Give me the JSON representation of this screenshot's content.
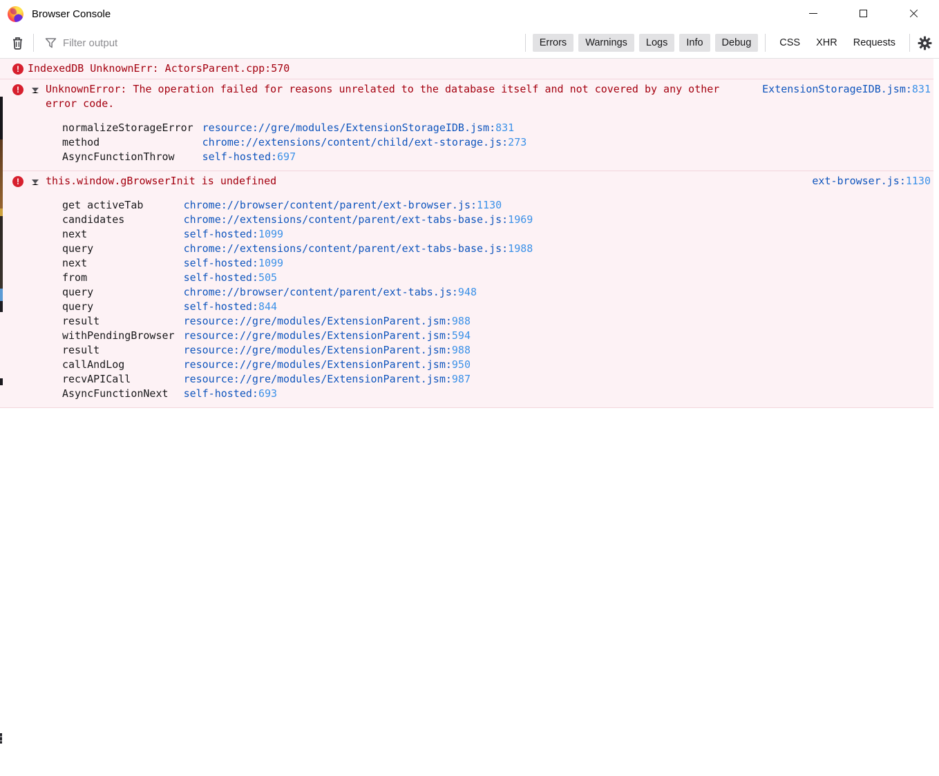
{
  "window": {
    "title": "Browser Console"
  },
  "toolbar": {
    "filter_placeholder": "Filter output",
    "filter_buttons": [
      "Errors",
      "Warnings",
      "Logs",
      "Info",
      "Debug"
    ],
    "category_buttons": [
      "CSS",
      "XHR",
      "Requests"
    ]
  },
  "icons": {
    "app_logo": "firefox-logo",
    "clear_output": "trash-can",
    "filter": "funnel",
    "settings": "gear",
    "window_controls": [
      "minimize",
      "maximize",
      "close"
    ],
    "message_severity": "error-circle-exclamation"
  },
  "palette": {
    "error_text": "#a4000f",
    "error_row_bg": "#fdf2f5",
    "error_row_border": "#f2d5db",
    "error_icon_red": "#d7202e",
    "link_file_blue": "#0f55bd",
    "link_line_blue": "#3b91e8",
    "button_bg": "#e2e2e4"
  },
  "console": {
    "messages": [
      {
        "severity": "error",
        "expandable": false,
        "text": "IndexedDB UnknownErr: ActorsParent.cpp:570",
        "location_file": "",
        "location_line": "",
        "stack": []
      },
      {
        "severity": "error",
        "expandable": true,
        "text": "UnknownError: The operation failed for reasons unrelated to the database itself and not covered by any other error code.",
        "location_file": "ExtensionStorageIDB.jsm",
        "location_line": "831",
        "stack": [
          {
            "fn": "normalizeStorageError",
            "file": "resource://gre/modules/ExtensionStorageIDB.jsm",
            "line": "831"
          },
          {
            "fn": "method",
            "file": "chrome://extensions/content/child/ext-storage.js",
            "line": "273"
          },
          {
            "fn": "AsyncFunctionThrow",
            "file": "self-hosted",
            "line": "697"
          }
        ]
      },
      {
        "severity": "error",
        "expandable": true,
        "text": "this.window.gBrowserInit is undefined",
        "location_file": "ext-browser.js",
        "location_line": "1130",
        "stack": [
          {
            "fn": "get activeTab",
            "file": "chrome://browser/content/parent/ext-browser.js",
            "line": "1130"
          },
          {
            "fn": "candidates",
            "file": "chrome://extensions/content/parent/ext-tabs-base.js",
            "line": "1969"
          },
          {
            "fn": "next",
            "file": "self-hosted",
            "line": "1099"
          },
          {
            "fn": "query",
            "file": "chrome://extensions/content/parent/ext-tabs-base.js",
            "line": "1988"
          },
          {
            "fn": "next",
            "file": "self-hosted",
            "line": "1099"
          },
          {
            "fn": "from",
            "file": "self-hosted",
            "line": "505"
          },
          {
            "fn": "query",
            "file": "chrome://browser/content/parent/ext-tabs.js",
            "line": "948"
          },
          {
            "fn": "query",
            "file": "self-hosted",
            "line": "844"
          },
          {
            "fn": "result",
            "file": "resource://gre/modules/ExtensionParent.jsm",
            "line": "988"
          },
          {
            "fn": "withPendingBrowser",
            "file": "resource://gre/modules/ExtensionParent.jsm",
            "line": "594"
          },
          {
            "fn": "result",
            "file": "resource://gre/modules/ExtensionParent.jsm",
            "line": "988"
          },
          {
            "fn": "callAndLog",
            "file": "resource://gre/modules/ExtensionParent.jsm",
            "line": "950"
          },
          {
            "fn": "recvAPICall",
            "file": "resource://gre/modules/ExtensionParent.jsm",
            "line": "987"
          },
          {
            "fn": "AsyncFunctionNext",
            "file": "self-hosted",
            "line": "693"
          }
        ]
      }
    ]
  }
}
